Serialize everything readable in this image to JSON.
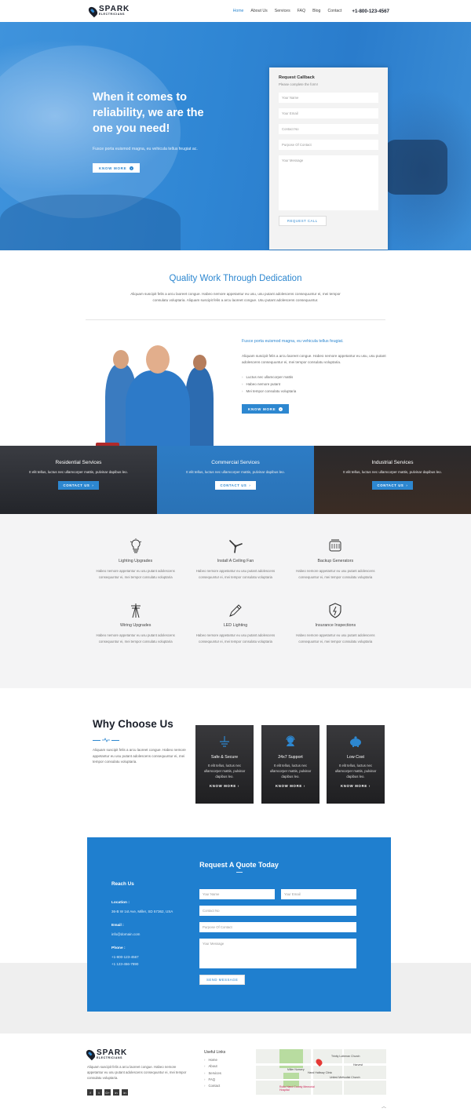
{
  "nav": {
    "logo_main": "SPARK",
    "logo_sub": "ELECTRICIANS",
    "items": [
      "Home",
      "About Us",
      "Services",
      "FAQ",
      "Blog",
      "Contact"
    ],
    "phone": "+1-800-123-4567"
  },
  "hero": {
    "headline": "When it comes to reliability, we are the one you need!",
    "text": "Fusce porta euismod magna, eu vehicula tellus feugiat ac.",
    "button": "KNOW MORE",
    "form": {
      "title": "Request Callback",
      "subtitle": "Please complete the form!",
      "name": "Your Name",
      "email": "Your Email",
      "contact": "Contact No",
      "purpose": "Purpose Of Contact",
      "message": "Your Message",
      "button": "REQUEST CALL"
    }
  },
  "quality": {
    "title": "Quality Work Through Dedication",
    "lead": "Aliquam suscipit felis a arcu laoreet congue. Habeo nemore appetantur eu usu, usu putant adolescens consequuntur ei, mei tempor consulatu voluptaria. Aliquam suscipit felis a arcu laoreet congue. Usu putant adolescens consequuntur.",
    "subtitle": "Fusce porta euismod magna, eu vehicula tellus feugiat.",
    "text": "Aliquam suscipit felis a arcu laoreet congue. Habeo nemore appetantur eu usu, usu putant adolescens consequuntur ei, mei tempor consulatu voluptaria.",
    "bullets": [
      "Luctus nec ullamcorper mattis",
      "Habeo nemore putant",
      "Mei tempor consulatu voluptaria"
    ],
    "button": "KNOW MORE"
  },
  "services": [
    {
      "title": "Residential Services",
      "text": "It elit tellus, luctus nec ullamcorper mattis, pulvinar dapibus leo.",
      "button": "CONTACT US"
    },
    {
      "title": "Commercial Services",
      "text": "It elit tellus, luctus nec ullamcorper mattis, pulvinar dapibus leo.",
      "button": "CONTACT US"
    },
    {
      "title": "Industrial Services",
      "text": "It elit tellus, luctus nec ullamcorper mattis, pulvinar dapibus leo.",
      "button": "CONTACT US"
    }
  ],
  "features": [
    {
      "title": "Lighting Upgrades",
      "text": "Habeo nemore appetantur eu usu putant adolescens consequuntur ei, mei tempor consulatu voluptaria",
      "icon": "bulb-icon"
    },
    {
      "title": "Install A Ceiling Fan",
      "text": "Habeo nemore appetantur eu usu putant adolescens consequuntur ei, mei tempor consulatu voluptaria",
      "icon": "fan-icon"
    },
    {
      "title": "Backup Generators",
      "text": "Habeo nemore appetantur eu usu putant adolescens consequuntur ei, mei tempor consulatu voluptaria",
      "icon": "generator-icon"
    },
    {
      "title": "Wiring Upgrades",
      "text": "Habeo nemore appetantur eu usu putant adolescens consequuntur ei, mei tempor consulatu voluptaria",
      "icon": "pylon-icon"
    },
    {
      "title": "LED Lighting",
      "text": "Habeo nemore appetantur eu usu putant adolescens consequuntur ei, mei tempor consulatu voluptaria",
      "icon": "pencil-icon"
    },
    {
      "title": "Insurance Inspections",
      "text": "Habeo nemore appetantur eu usu putant adolescens consequuntur ei, mei tempor consulatu voluptaria",
      "icon": "shield-icon"
    }
  ],
  "why": {
    "title": "Why Choose Us",
    "text": "Aliquam suscipit felis a arcu laoreet congue. Habeo nemore appetantur eu usu putant adolescens consequuntur ei, mei tempor consulatu voluptaria.",
    "cards": [
      {
        "title": "Safe & Secure",
        "text": "It elit tellus, luctus nec ullamcorper mattis, pulvinar dapibus leo.",
        "link": "KNOW MORE",
        "icon": "ground-icon"
      },
      {
        "title": "24x7 Support",
        "text": "It elit tellus, luctus nec ullamcorper mattis, pulvinar dapibus leo.",
        "link": "KNOW MORE",
        "icon": "headset-icon"
      },
      {
        "title": "Low Cost",
        "text": "It elit tellus, luctus nec ullamcorper mattis, pulvinar dapibus leo.",
        "link": "KNOW MORE",
        "icon": "piggybank-icon"
      }
    ]
  },
  "quote": {
    "title": "Request A Quote Today",
    "reach_title": "Reach Us",
    "location_label": "Location :",
    "location": "36-B W 1st Ave, Miller, SD 57362, USA",
    "email_label": "Email :",
    "email": "info@domain.com",
    "phone_label": "Phone :",
    "phone1": "+1-800-123-4567",
    "phone2": "+1 123-456-7890",
    "form": {
      "name": "Your Name",
      "email": "Your Email",
      "contact": "Contact No",
      "purpose": "Purpose Of Contact",
      "message": "Your Message",
      "button": "SEND MESSAGE"
    }
  },
  "footer": {
    "desc": "Aliquam suscipit felis a arcu laoreet congue. Habeo nemore appetantur eu usu putant adolescens consequuntur ei, mei tempor consulatu voluptaria.",
    "social": [
      "f",
      "t",
      "G+",
      "in",
      "in"
    ],
    "links_title": "Useful Links",
    "links": [
      "Home",
      "About",
      "Services",
      "FAQ",
      "Contact"
    ],
    "map_labels": [
      "Trinity Lutheran Church",
      "Miller Nursery",
      "Hand Hallway Clinic",
      "United Methodist Church",
      "Rolla Hand County Memorial Hospital",
      "Harvest"
    ]
  },
  "colors": {
    "accent": "#2d87d0",
    "dark": "#1a1f2a"
  }
}
